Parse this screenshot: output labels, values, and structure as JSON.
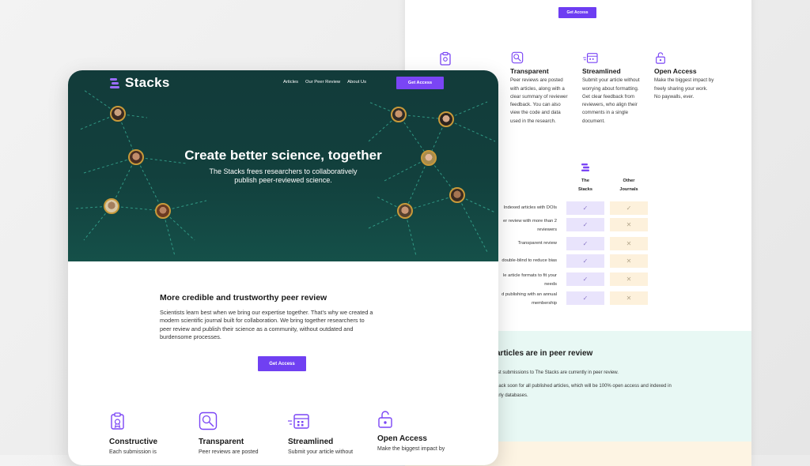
{
  "back": {
    "top_button": "Get Access",
    "features": [
      {
        "title": "Transparent",
        "icon": "magnifier-document-icon",
        "lines": [
          "Peer reviews are posted",
          "with articles, along with a",
          "clear summary of reviewer",
          "feedback. You can also",
          "view the code and data",
          "used in the research."
        ]
      },
      {
        "title": "Streamlined",
        "icon": "calendar-fast-icon",
        "lines": [
          "Submit your article without",
          "worrying about formatting.",
          "Get clear feedback from",
          "reviewers, who align their",
          "comments in a single",
          "document."
        ]
      },
      {
        "title": "Open Access",
        "icon": "unlock-icon",
        "lines": [
          "Make the biggest impact by",
          "freely sharing your work.",
          "No paywalls, ever."
        ]
      }
    ],
    "comparison": {
      "col1_line1": "The",
      "col1_line2": "Stacks",
      "col2_line1": "Other",
      "col2_line2": "Journals",
      "rows": [
        {
          "l1": "Indexed articles with DOIs",
          "l2": "",
          "a": "✓",
          "b": "✓"
        },
        {
          "l1": "er review with more than 2",
          "l2": "reviewers",
          "a": "✓",
          "b": "✕"
        },
        {
          "l1": "Transparent review",
          "l2": "",
          "a": "✓",
          "b": "✕"
        },
        {
          "l1": "double-blind to reduce bias",
          "l2": "",
          "a": "✓",
          "b": "✕"
        },
        {
          "l1": "le article formats to fit your",
          "l2": "needs",
          "a": "✓",
          "b": "✕"
        },
        {
          "l1": "d publishing with an annual",
          "l2": "membership",
          "a": "✓",
          "b": "✕"
        }
      ]
    },
    "status_heading": "articles are in peer review",
    "status_line1": "rst submissions to The Stacks are currently in peer review.",
    "status_line2": "back soon for all published articles, which will be 100% open access and indexed in",
    "status_line3": "arly databases."
  },
  "front": {
    "logo_text": "Stacks",
    "nav": [
      "Articles",
      "Our Peer Review",
      "About Us"
    ],
    "nav_button": "Get Access",
    "hero_title": "Create better science, together",
    "hero_sub_line1": "The Stacks frees researchers to collaboratively",
    "hero_sub_line2": "publish peer-reviewed science.",
    "section_title": "More credible and trustworthy peer review",
    "section_lines": [
      "Scientists learn best when we bring our expertise together. That’s why we created a",
      "modern scientific journal built for collaboration. We bring together researchers to",
      "peer review and publish their science as a community, without outdated and",
      "burdensome processes."
    ],
    "section_button": "Get Access",
    "features": [
      {
        "title": "Constructive",
        "desc": "Each submission is",
        "icon": "clipboard-award-icon"
      },
      {
        "title": "Transparent",
        "desc": "Peer reviews are posted",
        "icon": "magnifier-document-icon"
      },
      {
        "title": "Streamlined",
        "desc": "Submit your article without",
        "icon": "calendar-fast-icon"
      },
      {
        "title": "Open Access",
        "desc": "Make the biggest impact by",
        "icon": "unlock-icon"
      }
    ]
  },
  "colors": {
    "accent": "#7040f2",
    "hero": "#123b3a",
    "avatar_ring": "#c99a3a",
    "dash": "#3bb59c"
  }
}
